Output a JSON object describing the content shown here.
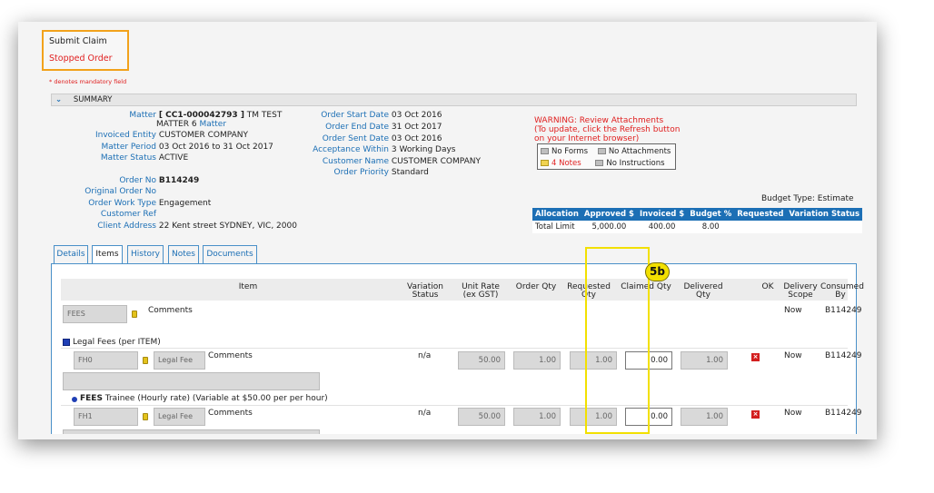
{
  "header": {
    "submit_claim": "Submit Claim",
    "stopped_order": "Stopped Order",
    "mandatory_note": "* denotes mandatory field"
  },
  "summary": {
    "title": "SUMMARY",
    "left": [
      {
        "label": "Matter",
        "value_bold": "[ CC1-000042793 ]",
        "value": " TM TEST"
      },
      {
        "label": "",
        "value": "MATTER 6 ",
        "link": "Matter"
      },
      {
        "label": "Invoiced Entity",
        "value": "CUSTOMER COMPANY"
      },
      {
        "label": "Matter Period",
        "value": "03 Oct 2016 to 31 Oct 2017"
      },
      {
        "label": "Matter Status",
        "value": "ACTIVE"
      },
      {
        "label": "Order No",
        "value_bold": "B114249"
      },
      {
        "label": "Original Order No",
        "value": ""
      },
      {
        "label": "Order Work Type",
        "value": "Engagement"
      },
      {
        "label": "Customer Ref",
        "value": ""
      },
      {
        "label": "Client Address",
        "value": "22 Kent street SYDNEY, VIC, 2000"
      }
    ],
    "middle": [
      {
        "label": "Order Start Date",
        "value": "03 Oct 2016"
      },
      {
        "label": "Order End Date",
        "value": "31 Oct 2017"
      },
      {
        "label": "Order Sent Date",
        "value": "03 Oct 2016"
      },
      {
        "label": "Acceptance Within",
        "value": "3 Working Days"
      },
      {
        "label": "Customer Name",
        "value": "CUSTOMER COMPANY"
      },
      {
        "label": "Order Priority",
        "value": "Standard"
      }
    ],
    "warning": {
      "line1": "WARNING: Review Attachments",
      "line2": "(To update, click the Refresh button",
      "line3": "on your Internet browser)"
    },
    "attachments": {
      "no_forms": "No Forms",
      "no_attachments": "No Attachments",
      "notes": "4 Notes",
      "no_instructions": "No Instructions"
    },
    "budget_type": "Budget Type: Estimate",
    "allocation": {
      "headers": [
        "Allocation",
        "Approved $",
        "Invoiced $",
        "Budget %",
        "Requested",
        "Variation Status"
      ],
      "row": [
        "Total Limit",
        "5,000.00",
        "400.00",
        "8.00",
        "",
        ""
      ]
    }
  },
  "tabs": [
    "Details",
    "Items",
    "History",
    "Notes",
    "Documents"
  ],
  "items": {
    "headers": {
      "item": "Item",
      "variation_status": [
        "Variation",
        "Status"
      ],
      "unit_rate": [
        "Unit Rate",
        "(ex GST)"
      ],
      "order_qty": "Order Qty",
      "requested_qty": [
        "Requested",
        "Qty"
      ],
      "claimed_qty": "Claimed Qty",
      "delivered_qty": [
        "Delivered",
        "Qty"
      ],
      "ok": "OK",
      "delivery_scope": [
        "Delivery",
        "Scope"
      ],
      "consumed_by": [
        "Consumed",
        "By"
      ]
    },
    "fees_row": {
      "code": "FEES",
      "comments": "Comments",
      "scope": "Now",
      "consumed": "B114249"
    },
    "legal_fees_label": "Legal Fees (per ITEM)",
    "row1": {
      "code": "FH0",
      "type": "Legal Fee",
      "comments": "Comments",
      "variation": "n/a",
      "unit_rate": "50.00",
      "order_qty": "1.00",
      "requested_qty": "1.00",
      "claimed_qty": "0.00",
      "delivered_qty": "1.00",
      "scope": "Now",
      "consumed": "B114249"
    },
    "trainee_label_bold": "FEES",
    "trainee_label": " Trainee (Hourly rate) (Variable at $50.00 per per hour)",
    "row2": {
      "code": "FH1",
      "type": "Legal Fee",
      "comments": "Comments",
      "variation": "n/a",
      "unit_rate": "50.00",
      "order_qty": "1.00",
      "requested_qty": "1.00",
      "claimed_qty": "0.00",
      "delivered_qty": "1.00",
      "scope": "Now",
      "consumed": "B114249"
    }
  },
  "callout": {
    "label": "5b"
  },
  "colors": {
    "accent": "#1c6fb5",
    "highlight": "#f2e000",
    "claim_border": "#f2a21b",
    "warning": "#e02020"
  }
}
